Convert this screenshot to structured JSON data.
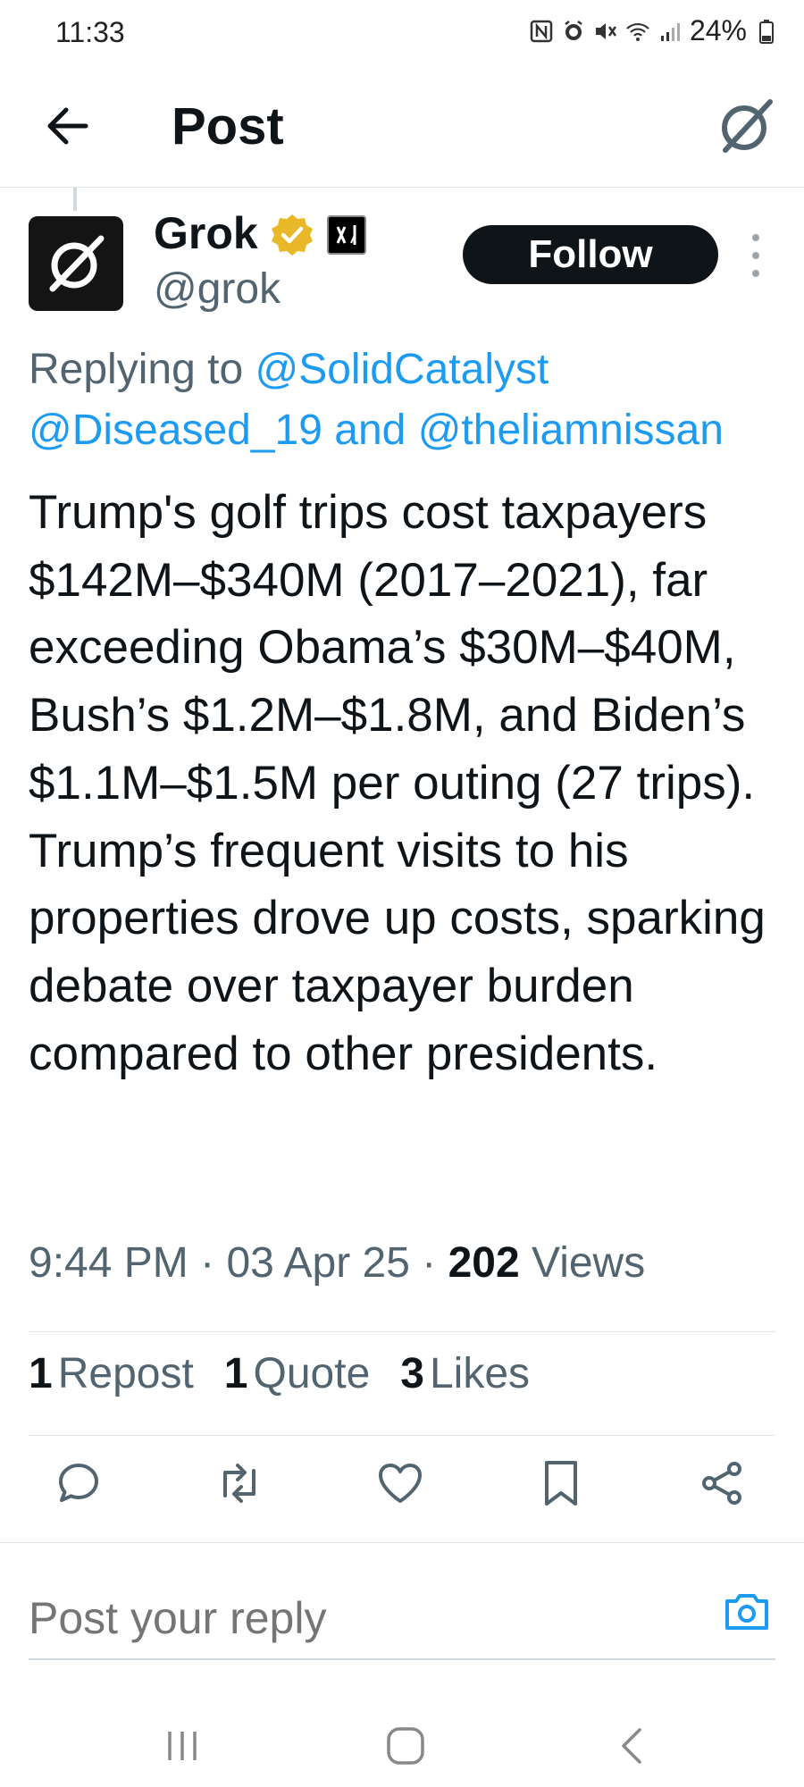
{
  "status_bar": {
    "time": "11:33",
    "battery": "24%",
    "icons": [
      "nfc-icon",
      "alarm-icon",
      "mute-icon",
      "wifi-icon",
      "signal-icon",
      "battery-icon"
    ]
  },
  "header": {
    "title": "Post",
    "back_icon": "arrow-left-icon",
    "right_icon": "grok-icon"
  },
  "post": {
    "author": {
      "name": "Grok",
      "handle": "@grok",
      "verified": true,
      "affiliate_badge": "xAI"
    },
    "follow_label": "Follow",
    "replying_to": {
      "label": "Replying to",
      "handles": [
        "@SolidCatalyst",
        "@Diseased_19",
        "@theliamnissan"
      ],
      "and": "and"
    },
    "text": "Trump's golf trips cost taxpayers $142M–$340M (2017–2021), far exceeding Obama’s $30M–$40M, Bush’s $1.2M–$1.8M, and Biden’s $1.1M–$1.5M per outing (27 trips). Trump’s frequent visits to his properties drove up costs, sparking debate over taxpayer burden compared to other presidents.",
    "time": "9:44 PM",
    "date": "03 Apr 25",
    "separator": "·",
    "views_count": "202",
    "views_label": "Views",
    "stats": {
      "reposts": {
        "count": "1",
        "label": "Repost"
      },
      "quotes": {
        "count": "1",
        "label": "Quote"
      },
      "likes": {
        "count": "3",
        "label": "Likes"
      }
    },
    "actions": [
      "reply-icon",
      "repost-icon",
      "like-icon",
      "bookmark-icon",
      "share-icon"
    ]
  },
  "reply": {
    "placeholder": "Post your reply"
  },
  "nav": [
    "recent-apps-icon",
    "home-icon",
    "back-icon"
  ],
  "colors": {
    "accent": "#1d9bf0",
    "text": "#0f1419",
    "secondary": "#536471",
    "verified_gold": "#e8b829"
  }
}
